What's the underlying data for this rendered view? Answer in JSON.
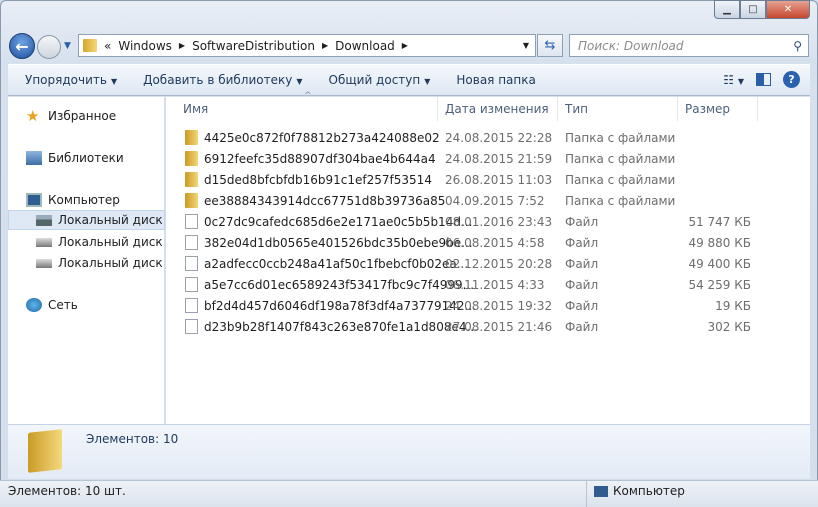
{
  "window": {
    "min": "▁",
    "max": "□",
    "close": "✕"
  },
  "address": {
    "overflow": "«",
    "crumbs": [
      "Windows",
      "SoftwareDistribution",
      "Download"
    ]
  },
  "search": {
    "placeholder": "Поиск: Download"
  },
  "toolbar": {
    "organize": "Упорядочить",
    "add_library": "Добавить в библиотеку",
    "share": "Общий доступ",
    "new_folder": "Новая папка"
  },
  "nav": {
    "favorites": "Избранное",
    "libraries": "Библиотеки",
    "computer": "Компьютер",
    "drives": [
      "Локальный диск (C:)",
      "Локальный диск (D:)",
      "Локальный диск (F:)"
    ],
    "network": "Сеть"
  },
  "columns": {
    "name": "Имя",
    "date": "Дата изменения",
    "type": "Тип",
    "size": "Размер"
  },
  "files": [
    {
      "name": "4425e0c872f0f78812b273a424088e02",
      "date": "24.08.2015 22:28",
      "type": "Папка с файлами",
      "size": "",
      "kind": "folder"
    },
    {
      "name": "6912feefc35d88907df304bae4b644a4",
      "date": "24.08.2015 21:59",
      "type": "Папка с файлами",
      "size": "",
      "kind": "folder"
    },
    {
      "name": "d15ded8bfcbfdb16b91c1ef257f53514",
      "date": "26.08.2015 11:03",
      "type": "Папка с файлами",
      "size": "",
      "kind": "folder"
    },
    {
      "name": "ee38884343914dcc67751d8b39736a85",
      "date": "04.09.2015 7:52",
      "type": "Папка с файлами",
      "size": "",
      "kind": "folder"
    },
    {
      "name": "0c27dc9cafedc685d6e2e171ae0c5b5b14d...",
      "date": "08.01.2016 23:43",
      "type": "Файл",
      "size": "51 747 КБ",
      "kind": "file"
    },
    {
      "name": "382e04d1db0565e401526bdc35b0ebe9be...",
      "date": "06.08.2015 4:58",
      "type": "Файл",
      "size": "49 880 КБ",
      "kind": "file"
    },
    {
      "name": "a2adfecc0ccb248a41af50c1fbebcf0b02ea...",
      "date": "02.12.2015 20:28",
      "type": "Файл",
      "size": "49 400 КБ",
      "kind": "file"
    },
    {
      "name": "a5e7cc6d01ec6589243f53417fbc9c7f4999...",
      "date": "06.11.2015 4:33",
      "type": "Файл",
      "size": "54 259 КБ",
      "kind": "file"
    },
    {
      "name": "bf2d4d457d6046df198a78f3df4a73779142...",
      "date": "24.08.2015 19:32",
      "type": "Файл",
      "size": "19 КБ",
      "kind": "file"
    },
    {
      "name": "d23b9b28f1407f843c263e870fe1a1d808e4...",
      "date": "27.08.2015 21:46",
      "type": "Файл",
      "size": "302 КБ",
      "kind": "file"
    }
  ],
  "details": {
    "count": "Элементов: 10"
  },
  "status": {
    "count": "Элементов: 10 шт.",
    "location": "Компьютер"
  }
}
